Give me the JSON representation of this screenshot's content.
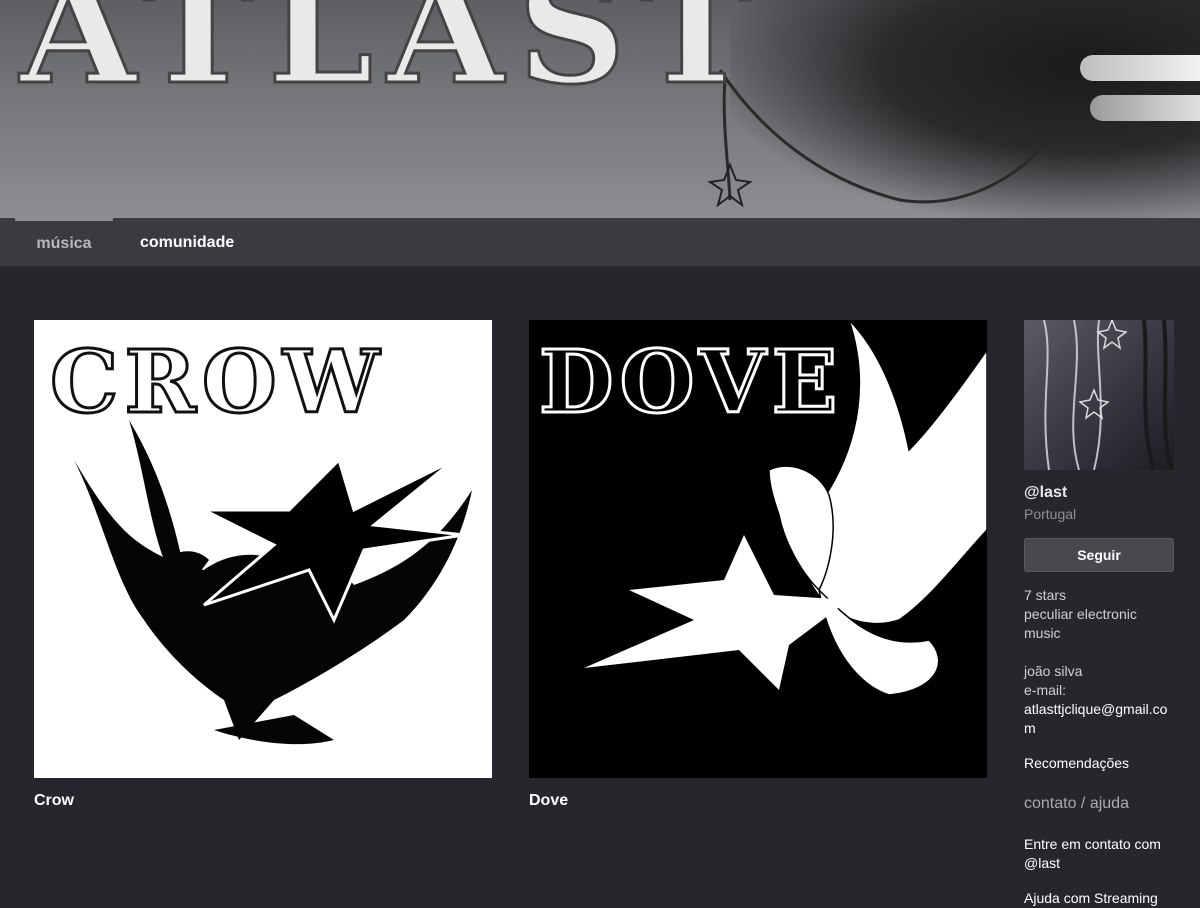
{
  "banner": {
    "logo_text": "ATLAST"
  },
  "nav": {
    "tabs": [
      {
        "label": "música",
        "active": true
      },
      {
        "label": "comunidade",
        "active": false
      }
    ]
  },
  "albums": [
    {
      "cover_text": "CROW",
      "title": "Crow",
      "cover_bg": "#ffffff",
      "cover_fg": "#000000"
    },
    {
      "cover_text": "DOVE",
      "title": "Dove",
      "cover_bg": "#000000",
      "cover_fg": "#ffffff"
    }
  ],
  "sidebar": {
    "artist_name": "@last",
    "location": "Portugal",
    "follow_label": "Seguir",
    "bio_line1": "7 stars",
    "bio_line2": "peculiar electronic music",
    "bio_name": "joão silva",
    "bio_email_label": "e-mail:",
    "bio_email": "atlasttjclique@gmail.com",
    "recommendations_label": "Recomendações",
    "contact_heading": "contato / ajuda",
    "contact_link": "Entre em contato com @last",
    "help_link": "Ajuda com Streaming"
  },
  "colors": {
    "page_bg": "#26272c",
    "nav_bg": "#3a3b40",
    "button_bg": "#48494e"
  }
}
